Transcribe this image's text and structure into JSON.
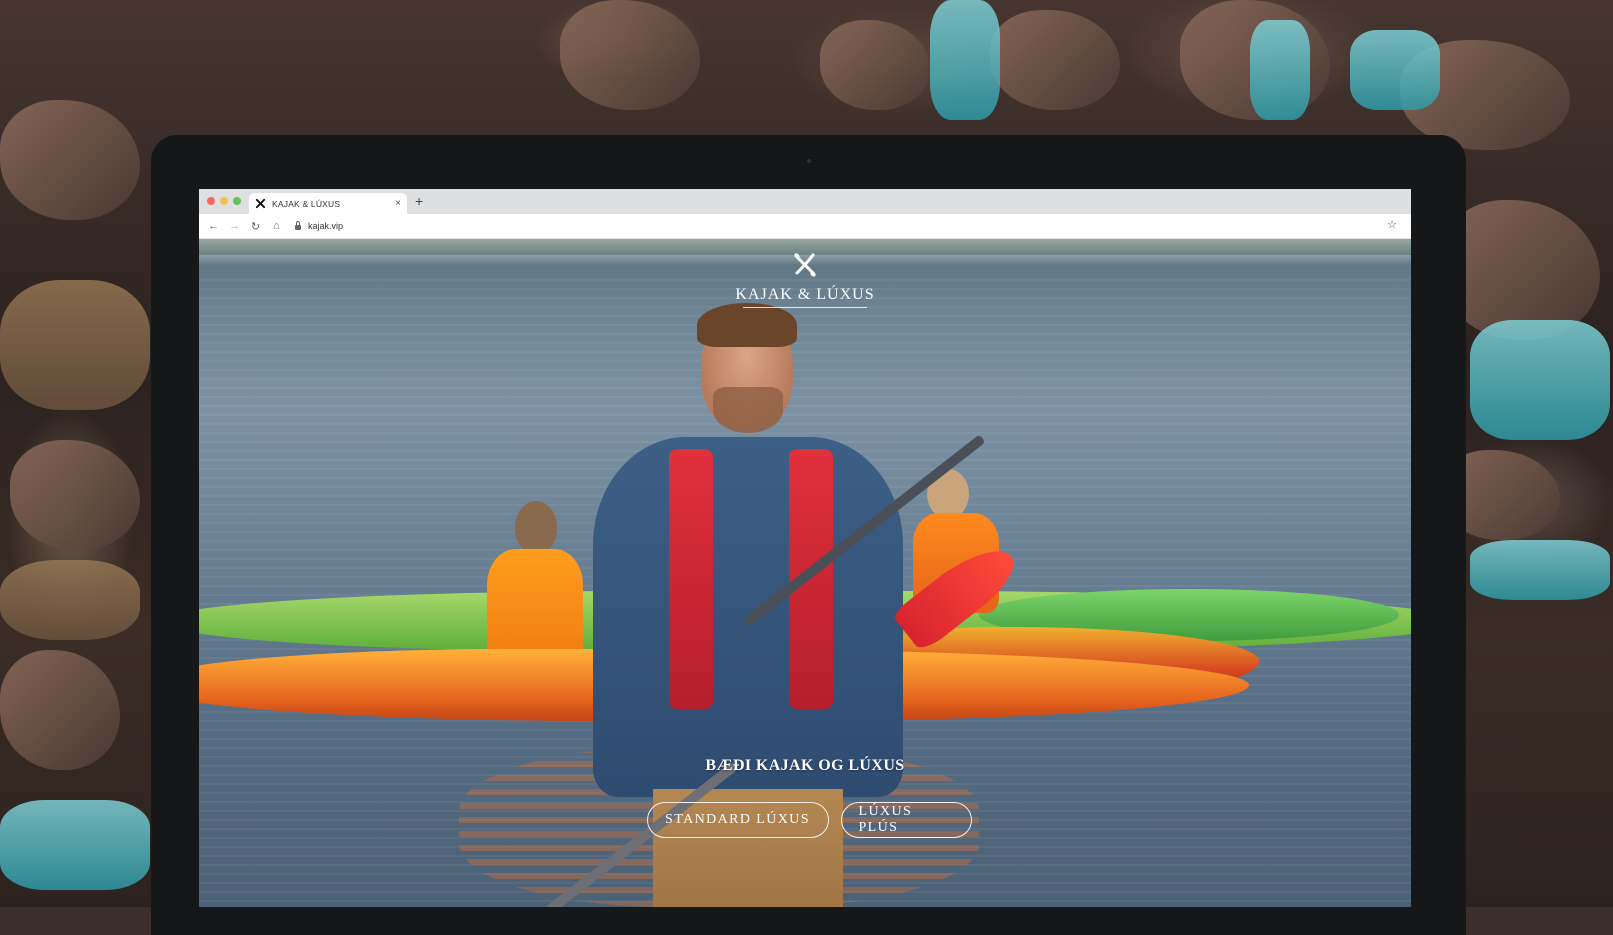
{
  "browser": {
    "tab_title": "KAJAK & LÚXUS",
    "tab_close": "×",
    "new_tab": "+",
    "url": "kajak.vip"
  },
  "icons": {
    "back": "back-arrow-icon",
    "forward": "forward-arrow-icon",
    "reload": "reload-icon",
    "home": "home-icon",
    "lock": "lock-icon",
    "bookmark": "star-icon",
    "logo": "kayak-paddles-logo-icon"
  },
  "site": {
    "logo_text": "KAJAK & LÚXUS",
    "hero_title": "BÆÐI KAJAK OG LÚXUS",
    "buttons": [
      "STANDARD LÚXUS",
      "LÚXUS PLÚS"
    ]
  },
  "colors": {
    "device_frame": "#161719",
    "tab_bar": "#dedfe1",
    "paddle_red": "#d8232f",
    "vest_orange": "#f07a10"
  }
}
